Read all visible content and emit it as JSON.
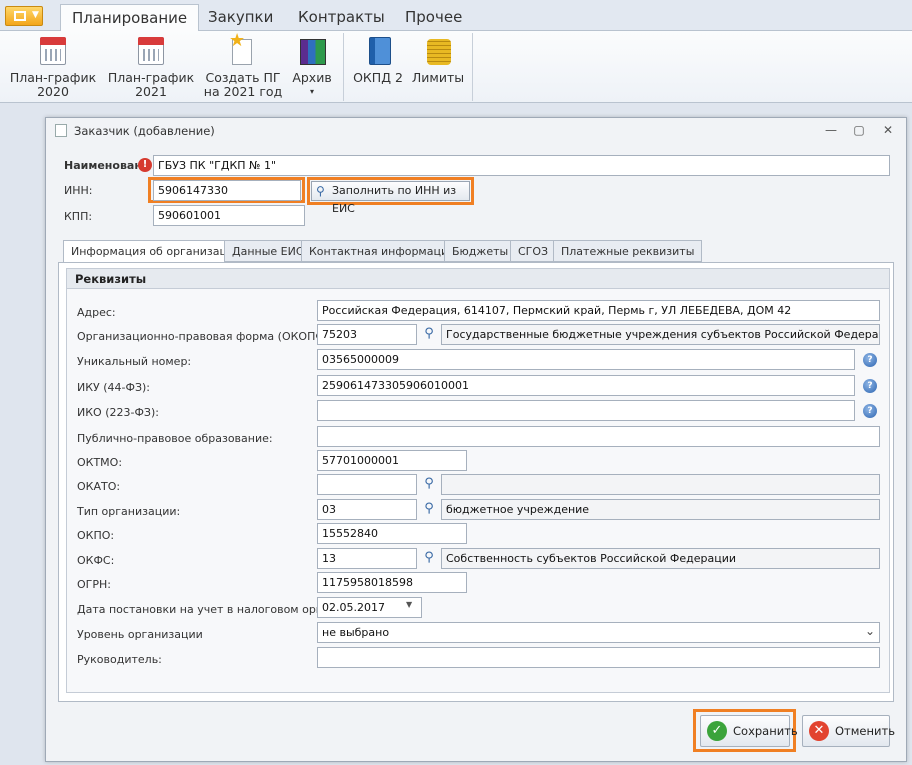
{
  "ribbon": {
    "tabs": [
      "Планирование",
      "Закупки",
      "Контракты",
      "Прочее"
    ],
    "buttons": {
      "plan2020": {
        "line1": "План-график",
        "line2": "2020"
      },
      "plan2021": {
        "line1": "План-график",
        "line2": "2021"
      },
      "create": {
        "line1": "Создать ПГ",
        "line2": "на 2021 год"
      },
      "archive": {
        "line1": "Архив",
        "line2": "▾"
      },
      "okpd": {
        "line1": "ОКПД 2"
      },
      "limits": {
        "line1": "Лимиты"
      }
    }
  },
  "window": {
    "title": "Заказчик (добавление)",
    "controls": [
      "—",
      "▢",
      "✕"
    ]
  },
  "header": {
    "name_label": "Наименован",
    "name_value": "ГБУЗ ПК \"ГДКП № 1\"",
    "inn_label": "ИНН:",
    "inn_value": "5906147330",
    "fill_button": "Заполнить по ИНН из ЕИС",
    "kpp_label": "КПП:",
    "kpp_value": "590601001"
  },
  "tabs": [
    "Информация об организации",
    "Данные ЕИС",
    "Контактная информация",
    "Бюджеты",
    "СГОЗ",
    "Платежные реквизиты"
  ],
  "group_title": "Реквизиты",
  "fields": {
    "address": {
      "label": "Адрес:",
      "value": "Российская Федерация, 614107, Пермский край, Пермь г, УЛ ЛЕБЕДЕВА, ДОМ 42"
    },
    "okopf": {
      "label": "Организационно-правовая форма (ОКОПФ):",
      "code": "75203",
      "text": "Государственные бюджетные учреждения субъектов Российской Федерации"
    },
    "unique": {
      "label": "Уникальный номер:",
      "value": "03565000009"
    },
    "iku": {
      "label": "ИКУ (44-ФЗ):",
      "value": "259061473305906010001"
    },
    "iko": {
      "label": "ИКО (223-ФЗ):",
      "value": ""
    },
    "ppo": {
      "label": "Публично-правовое образование:",
      "value": ""
    },
    "oktmo": {
      "label": "ОКТМО:",
      "value": "57701000001"
    },
    "okato": {
      "label": "ОКАТО:",
      "code": "",
      "text": ""
    },
    "orgtype": {
      "label": "Тип организации:",
      "code": "03",
      "text": "бюджетное учреждение"
    },
    "okpo": {
      "label": "ОКПО:",
      "value": "15552840"
    },
    "okfs": {
      "label": "ОКФС:",
      "code": "13",
      "text": "Собственность субъектов Российской Федерации"
    },
    "ogrn": {
      "label": "ОГРН:",
      "value": "1175958018598"
    },
    "regdate": {
      "label": "Дата постановки на учет в налоговом органе:",
      "value": "02.05.2017"
    },
    "level": {
      "label": "Уровень организации",
      "value": "не выбрано"
    },
    "head": {
      "label": "Руководитель:",
      "value": ""
    }
  },
  "footer": {
    "save": "Сохранить",
    "cancel": "Отменить"
  },
  "colors": {
    "highlight": "#f07f23",
    "accent": "#2d65b1"
  }
}
